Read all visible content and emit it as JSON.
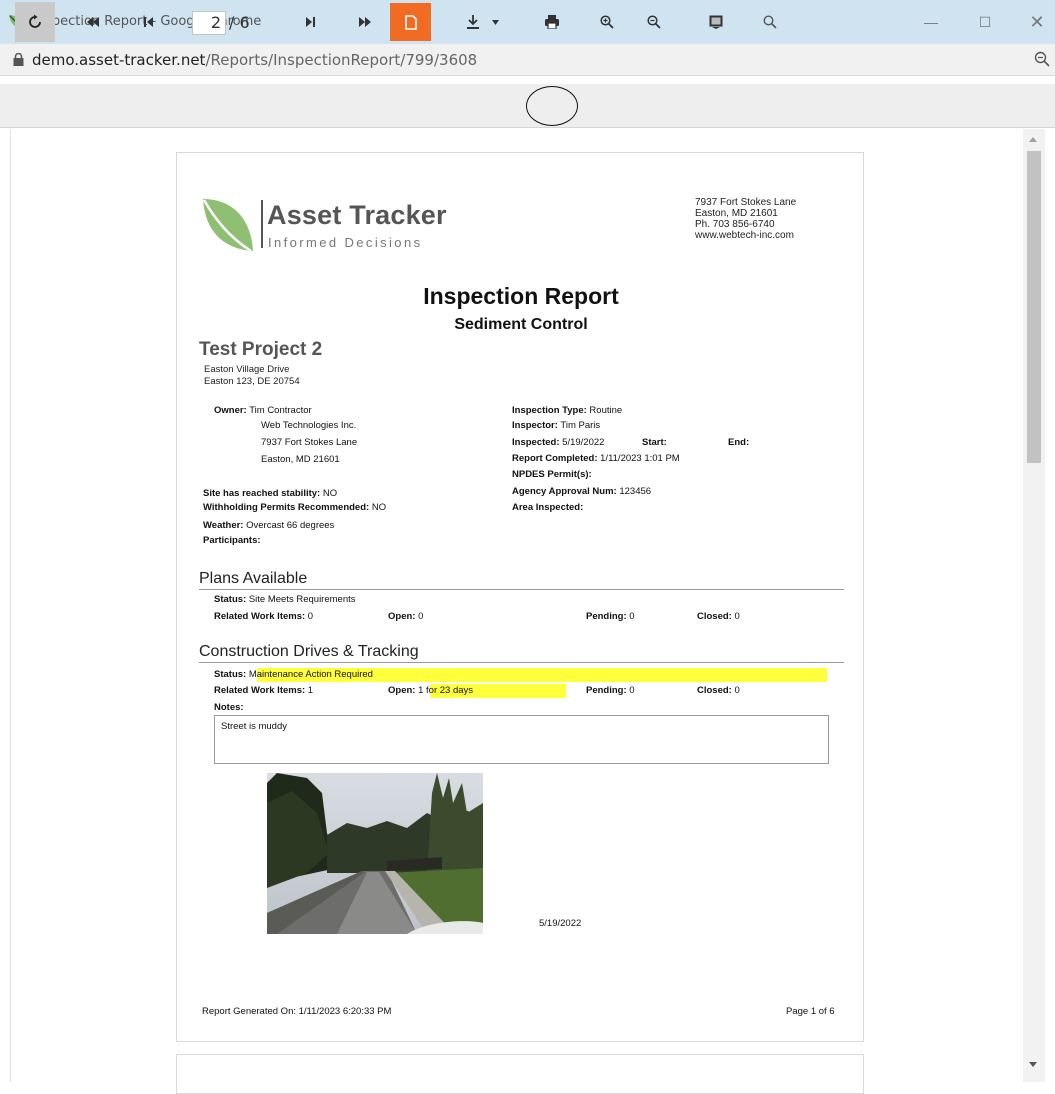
{
  "window": {
    "title": "Inspection Report - Google Chrome",
    "url_host": "demo.asset-tracker.net",
    "url_path": "/Reports/InspectionReport/799/3608"
  },
  "toolbar": {
    "current_page": "2",
    "total_pages": "/ 6",
    "icons": [
      "refresh-icon",
      "first-page-icon",
      "previous-page-icon",
      "next-page-icon",
      "last-page-icon",
      "single-page-icon",
      "download-icon",
      "print-icon",
      "zoom-in-icon",
      "zoom-out-icon",
      "fit-page-icon",
      "search-icon"
    ],
    "accent_color": "#f26b22"
  },
  "report": {
    "logo_name": "Asset Tracker",
    "logo_tagline": "Informed Decisions",
    "company_address": [
      "7937 Fort Stokes Lane",
      "Easton, MD 21601",
      "Ph. 703 856-6740",
      "www.webtech-inc.com"
    ],
    "title": "Inspection Report",
    "subtitle": "Sediment Control",
    "project_name": "Test Project 2",
    "project_address": [
      "Easton Village Drive",
      "Easton 123, DE 20754"
    ],
    "owner_label": "Owner:",
    "owner_lines": [
      "Tim Contractor",
      "Web Technologies Inc.",
      "7937 Fort Stokes Lane",
      "Easton, MD 21601"
    ],
    "stability_label": "Site has reached stability:",
    "stability_value": "NO",
    "withholding_label": "Withholding Permits Recommended:",
    "withholding_value": "NO",
    "weather_label": "Weather:",
    "weather_value": "Overcast 66 degrees",
    "participants_label": "Participants:",
    "inspection_type_label": "Inspection Type:",
    "inspection_type_value": "Routine",
    "inspector_label": "Inspector:",
    "inspector_value": "Tim Paris",
    "inspected_label": "Inspected:",
    "inspected_value": "5/19/2022",
    "start_label": "Start:",
    "end_label": "End:",
    "report_completed_label": "Report Completed:",
    "report_completed_value": "1/11/2023 1:01 PM",
    "npdes_label": "NPDES Permit(s):",
    "agency_label": "Agency Approval Num:",
    "agency_value": "123456",
    "area_label": "Area Inspected:",
    "sections": [
      {
        "title": "Plans Available",
        "status_label": "Status:",
        "status_value": "Site Meets Requirements",
        "related_label": "Related Work Items:",
        "related_value": "0",
        "open_label": "Open:",
        "open_value": "0",
        "pending_label": "Pending:",
        "pending_value": "0",
        "closed_label": "Closed:",
        "closed_value": "0"
      },
      {
        "title": "Construction Drives & Tracking",
        "status_label": "Status:",
        "status_value": "Maintenance Action Required",
        "related_label": "Related Work Items:",
        "related_value": "1",
        "open_label": "Open:",
        "open_value": "1 for 23 days",
        "pending_label": "Pending:",
        "pending_value": "0",
        "closed_label": "Closed:",
        "closed_value": "0",
        "notes_label": "Notes:",
        "notes_value": "Street is muddy",
        "photo_date": "5/19/2022",
        "highlight_color": "#ffff3c"
      }
    ],
    "footer_generated": "Report Generated On: 1/11/2023 6:20:33 PM",
    "footer_page": "Page 1 of 6"
  }
}
